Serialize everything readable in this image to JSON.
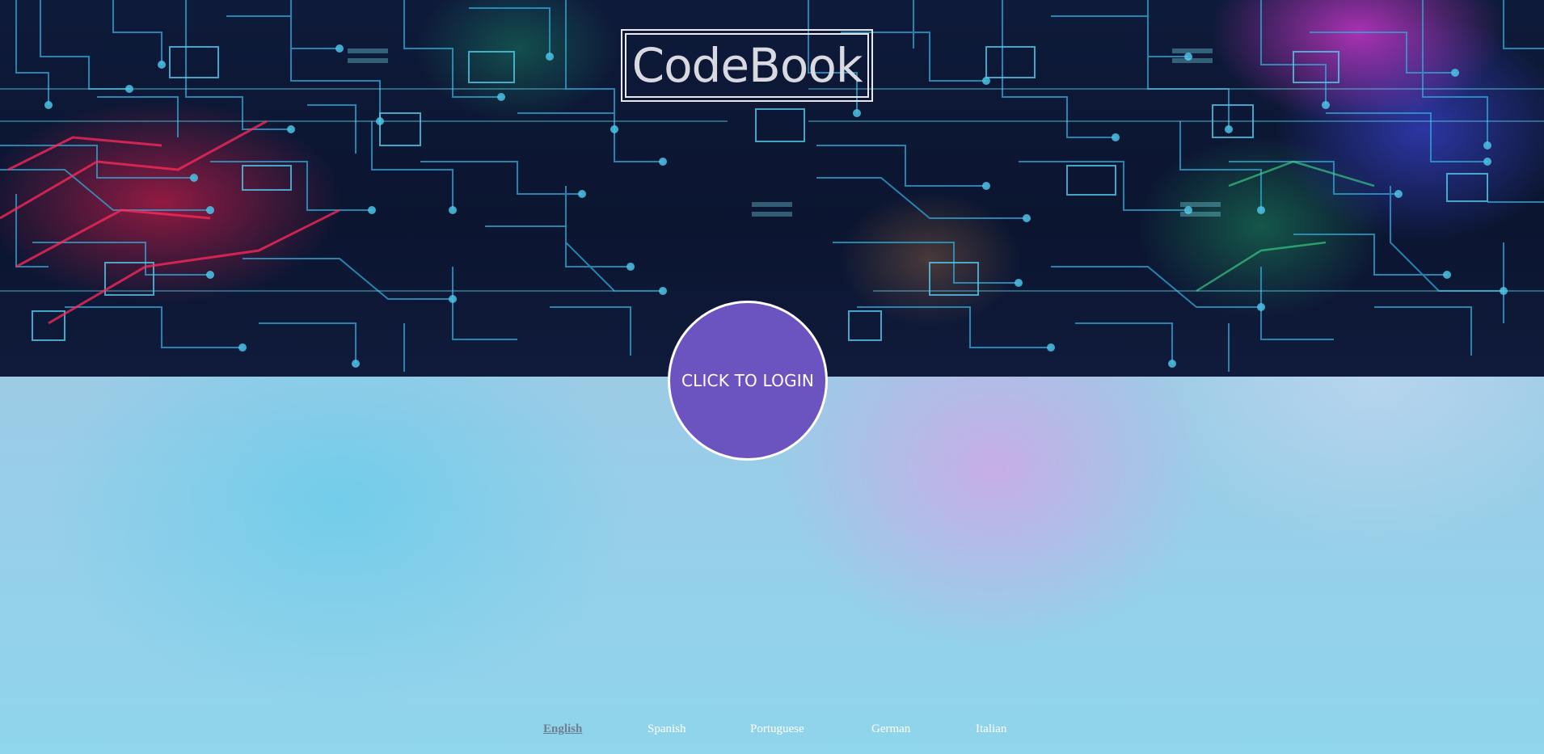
{
  "header": {
    "logo_text": "CodeBook",
    "background_icon": "circuit-board-pattern"
  },
  "login": {
    "label": "CLICK TO LOGIN",
    "color": "#6b54c0"
  },
  "languages": {
    "items": [
      {
        "label": "English",
        "selected": true
      },
      {
        "label": "Spanish",
        "selected": false
      },
      {
        "label": "Portuguese",
        "selected": false
      },
      {
        "label": "German",
        "selected": false
      },
      {
        "label": "Italian",
        "selected": false
      }
    ],
    "selected_color": "#6f7e8e",
    "color": "#ffffff"
  }
}
